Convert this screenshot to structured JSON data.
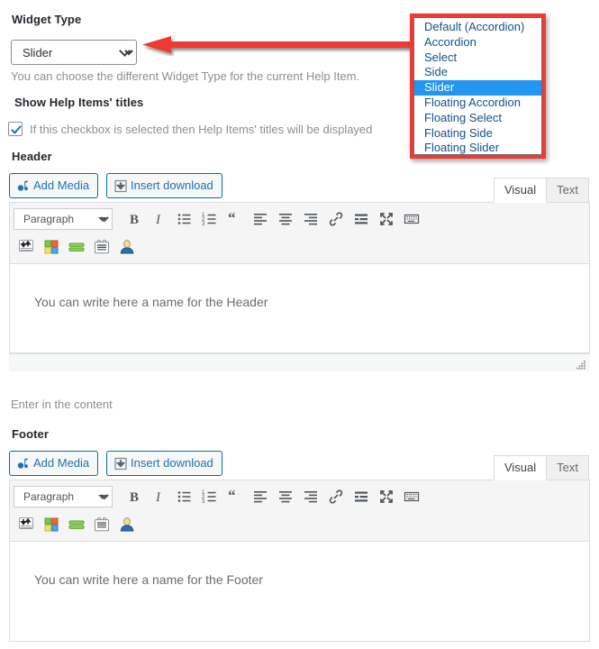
{
  "widget_type": {
    "label": "Widget Type",
    "selected": "Slider",
    "description": "You can choose the different Widget Type for the current Help Item.",
    "chevron_icon": "chevron-down-icon",
    "options": [
      "Default (Accordion)",
      "Accordion",
      "Select",
      "Side",
      "Slider",
      "Floating Accordion",
      "Floating Select",
      "Floating Side",
      "Floating Slider"
    ],
    "highlight_color": "#2196f3",
    "option_text_color": "#15508f",
    "callout_border_color": "#ee3b33"
  },
  "annotation": {
    "arrow_icon": "left-arrow-annotation",
    "arrow_color": "#ee3b33"
  },
  "show_titles": {
    "label": "Show Help Items' titles",
    "checkbox_label": "If this checkbox is selected then Help Items' titles will be displayed",
    "checked": true,
    "check_icon": "checkmark-icon"
  },
  "sections": {
    "header_label": "Header",
    "enter_content_label": "Enter in the content",
    "footer_label": "Footer"
  },
  "editor": {
    "add_media_label": "Add Media",
    "add_media_icon": "media-icon",
    "insert_download_label": "Insert download",
    "insert_download_icon": "download-icon",
    "tabs": [
      {
        "label": "Visual",
        "active": true
      },
      {
        "label": "Text",
        "active": false
      }
    ],
    "format_select": "Paragraph",
    "format_caret_icon": "caret-down-icon",
    "toolbar_row1": [
      "bold-icon",
      "italic-icon",
      "bulleted-list-icon",
      "numbered-list-icon",
      "blockquote-icon",
      "align-left-icon",
      "align-center-icon",
      "align-right-icon",
      "link-icon",
      "insert-read-more-icon",
      "fullscreen-icon",
      "toolbar-toggle-icon"
    ],
    "toolbar_row2": [
      "insert-updown-icon",
      "color-blocks-icon",
      "green-bars-icon",
      "lined-box-icon",
      "user-avatar-icon"
    ],
    "resize_handle_icon": "resize-grip-icon"
  },
  "header_editor": {
    "placeholder": "You can write here a name for the Header"
  },
  "footer_editor": {
    "placeholder": "You can write here a name for the Footer"
  }
}
